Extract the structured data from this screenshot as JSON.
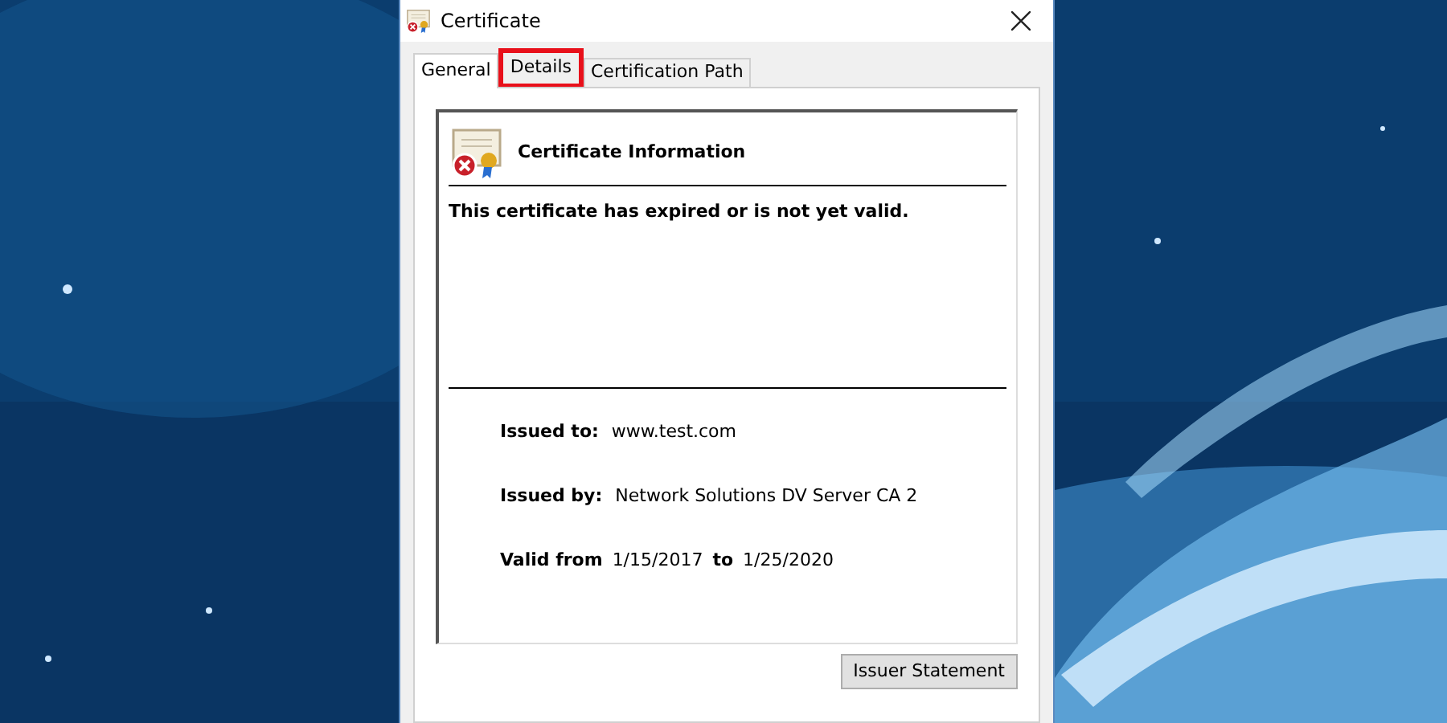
{
  "window": {
    "title": "Certificate"
  },
  "tabs": [
    {
      "label": "General",
      "selected": true,
      "highlighted": false
    },
    {
      "label": "Details",
      "selected": false,
      "highlighted": true
    },
    {
      "label": "Certification Path",
      "selected": false,
      "highlighted": false
    }
  ],
  "info": {
    "heading": "Certificate Information",
    "message": "This certificate has expired or is not yet valid.",
    "fields": [
      {
        "kind": "single",
        "label": "Issued to:",
        "value": "www.test.com"
      },
      {
        "kind": "single",
        "label": "Issued by:",
        "value": "Network Solutions DV Server CA 2"
      },
      {
        "kind": "range",
        "label": "Valid from",
        "from": "1/15/2017",
        "separator": "to",
        "to": "1/25/2020"
      }
    ]
  },
  "buttons": [
    "Issuer Statement"
  ]
}
